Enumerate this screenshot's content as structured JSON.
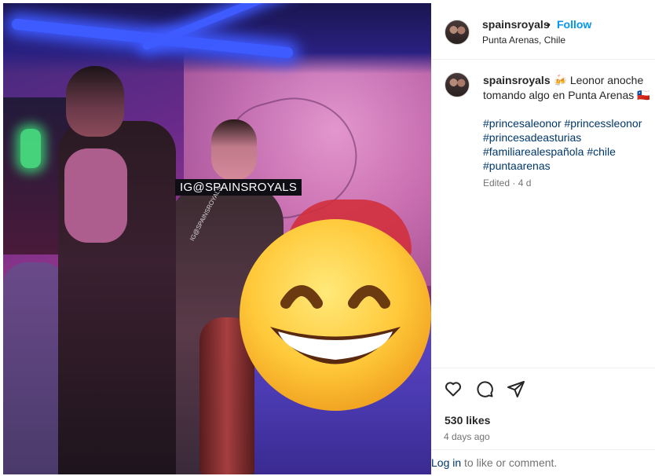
{
  "header": {
    "username": "spainsroyals",
    "separator": "•",
    "follow_label": "Follow",
    "location": "Punta Arenas, Chile"
  },
  "photo": {
    "watermark_box": "IG@SPAINSROYALS",
    "watermark_small": "IG@SPAINSROYALS"
  },
  "caption": {
    "username": "spainsroyals",
    "emoji": "🍻",
    "line1_rest": " Leonor anoche",
    "line2": "tomando algo en Punta Arenas 🇨🇱",
    "hashtags": [
      "#princesaleonor",
      "#princessleonor",
      "#princesadeasturias",
      "#familiarealespañola",
      "#chile",
      "#puntaarenas"
    ],
    "edited": "Edited · 4 d"
  },
  "actions": {
    "like_icon": "heart-icon",
    "comment_icon": "comment-icon",
    "share_icon": "share-icon",
    "likes": "530 likes",
    "ago": "4 days ago"
  },
  "comment_bar": {
    "login_label": "Log in",
    "rest": " to like or comment."
  },
  "colors": {
    "follow": "#0095f6",
    "hashtag": "#00376b",
    "muted": "#737373"
  }
}
